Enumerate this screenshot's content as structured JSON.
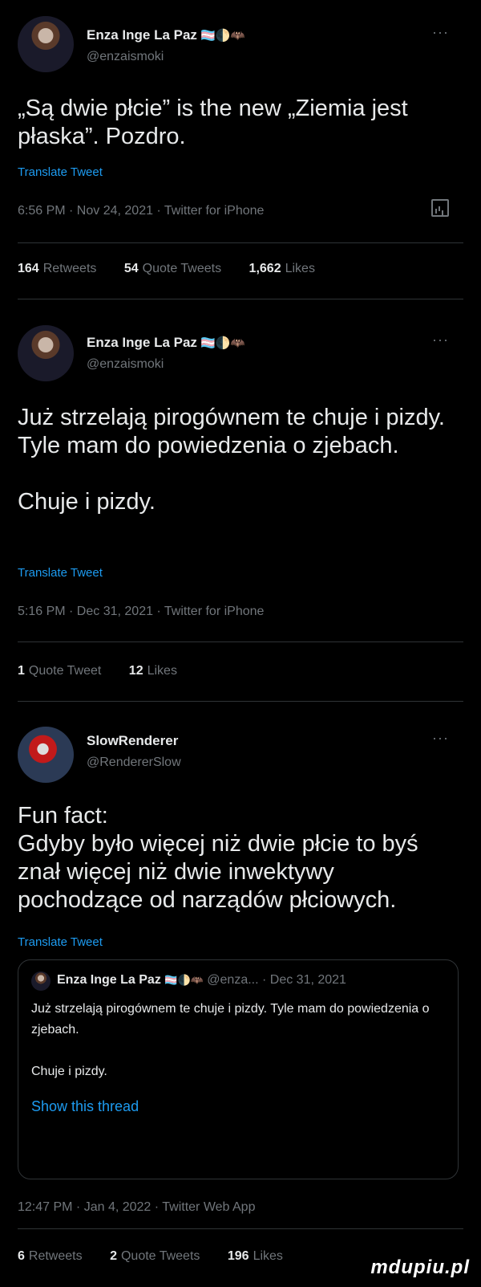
{
  "tweets": [
    {
      "name": "Enza Inge La Paz",
      "emoji": "🏳️‍⚧️🌓🦇",
      "handle": "@enzaismoki",
      "more": "···",
      "text": "„Są dwie płcie” is the new „Ziemia jest płaska”. Pozdro.",
      "translate": "Translate Tweet",
      "meta": "6:56 PM · Nov 24, 2021 · Twitter for iPhone",
      "stats": [
        {
          "count": "164",
          "label": "Retweets"
        },
        {
          "count": "54",
          "label": "Quote Tweets"
        },
        {
          "count": "1,662",
          "label": "Likes"
        }
      ]
    },
    {
      "name": "Enza Inge La Paz",
      "emoji": "🏳️‍⚧️🌓🦇",
      "handle": "@enzaismoki",
      "more": "···",
      "text_p1": "Już strzelają pirogównem te chuje i pizdy. Tyle mam do powiedzenia o zjebach.",
      "text_p2": "Chuje i pizdy.",
      "translate": "Translate Tweet",
      "meta": "5:16 PM · Dec 31, 2021 · Twitter for iPhone",
      "stats": [
        {
          "count": "1",
          "label": "Quote Tweet"
        },
        {
          "count": "12",
          "label": "Likes"
        }
      ]
    },
    {
      "name": "SlowRenderer",
      "handle": "@RendererSlow",
      "more": "···",
      "text": "Fun fact:\nGdyby było więcej niż dwie płcie to byś znał więcej niż dwie inwektywy pochodzące od narządów płciowych.",
      "translate": "Translate Tweet",
      "quote": {
        "name": "Enza Inge La Paz",
        "emoji": "🏳️‍⚧️🌓🦇",
        "meta": "@enza... · Dec 31, 2021",
        "text_p1": "Już strzelają pirogównem te chuje i pizdy. Tyle mam do powiedzenia o zjebach.",
        "text_p2": "Chuje i pizdy.",
        "link": "Show this thread"
      },
      "meta": "12:47 PM · Jan 4, 2022 · Twitter Web App",
      "stats": [
        {
          "count": "6",
          "label": "Retweets"
        },
        {
          "count": "2",
          "label": "Quote Tweets"
        },
        {
          "count": "196",
          "label": "Likes"
        }
      ]
    }
  ],
  "watermark": "mdupiu.pl"
}
